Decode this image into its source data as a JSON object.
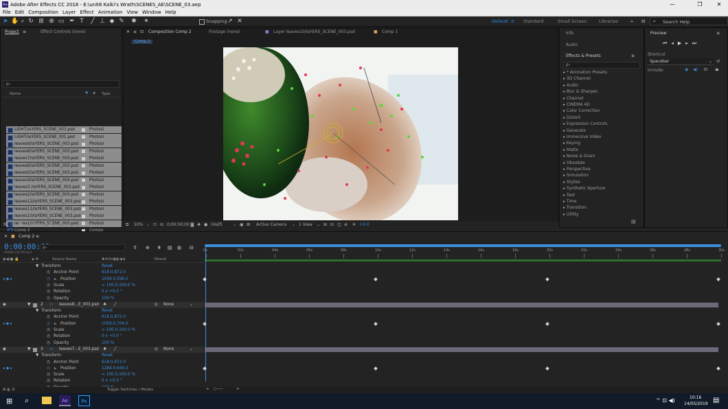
{
  "window": {
    "title": "Adobe After Effects CC 2018 - E:\\unit8 Kalki's Wrath\\SCENES_AE\\SCENE_03.aep",
    "controls": [
      "—",
      "❐",
      "✕"
    ]
  },
  "menu": [
    "File",
    "Edit",
    "Composition",
    "Layer",
    "Effect",
    "Animation",
    "View",
    "Window",
    "Help"
  ],
  "toolbar": {
    "snapping": "Snapping",
    "workspaces": [
      "Default",
      "Standard",
      "Small Screen",
      "Libraries"
    ],
    "active_workspace": "Default",
    "search_help": "Search Help",
    "accent": "#2d8ceb"
  },
  "project_panel": {
    "tabs": [
      "Project",
      "Effect Controls (none)"
    ],
    "col_name": "Name",
    "col_type": "Type",
    "items": [
      {
        "name": "LIGHT/laYERS_SCENE_003.psd",
        "type": "Photosl",
        "selected": true
      },
      {
        "name": "LIGHT/laYERS_SCENE_001.psd",
        "type": "Photosl",
        "selected": true
      },
      {
        "name": "leaves9/laYERS_SCENE_003.psd",
        "type": "Photosl",
        "selected": true
      },
      {
        "name": "leaves8/laYERS_SCENE_003.psd",
        "type": "Photosl",
        "selected": true
      },
      {
        "name": "leaves7/laYERS_SCENE_003.psd",
        "type": "Photosl",
        "selected": true
      },
      {
        "name": "leaves6/laYERS_SCENE_003.psd",
        "type": "Photosl",
        "selected": true
      },
      {
        "name": "leaves5/laYERS_SCENE_003.psd",
        "type": "Photosl",
        "selected": true
      },
      {
        "name": "leaves4/laYERS_SCENE_003.psd",
        "type": "Photosl",
        "selected": true
      },
      {
        "name": "leaves3 /laYERS_SCENE_003.psd",
        "type": "Photosl",
        "selected": true
      },
      {
        "name": "leaves2/laYERS_SCENE_003.psd",
        "type": "Photosl",
        "selected": true
      },
      {
        "name": "leaves12/laYERS_SCENE_003.psd",
        "type": "Photosl",
        "selected": true
      },
      {
        "name": "leaves11/laYERS_SCENE_003.psd",
        "type": "Photosl",
        "selected": true
      },
      {
        "name": "leaves10/laYERS_SCENE_003.psd",
        "type": "Photosl",
        "selected": true
      },
      {
        "name": "leaves1/laYERS_SCENE_003.psd",
        "type": "Photosl",
        "selected": true
      },
      {
        "name": "Comp 2",
        "type": "Compo",
        "selected": false
      },
      {
        "name": "Comp 1",
        "type": "Compo",
        "selected": false
      },
      {
        "name": "BRIDGE8..7/laYERS_SCENE_003.psd",
        "type": "Photosl",
        "selected": false
      },
      {
        "name": "BRIDGE8..7/laYERS_SCENE_003.psd",
        "type": "Photosl",
        "selected": false
      }
    ],
    "bpc": "8 bpc"
  },
  "viewer": {
    "tabs": [
      "Composition Comp 2",
      "Footage (none)",
      "Layer leaves10/laYERS_SCENE_003.psd",
      "Comp 1"
    ],
    "comp_tag": "Comp 2",
    "zoom": "50%",
    "timecode": "0;00;00;00",
    "resolution": "(Half)",
    "camera": "Active Camera",
    "views": "1 View",
    "exposure": "+0.0"
  },
  "right_panels": {
    "info": "Info",
    "audio": "Audio",
    "effects_title": "Effects & Presets",
    "search_placeholder": "ρ₊",
    "effects": [
      "* Animation Presets",
      "3D Channel",
      "Audio",
      "Blur & Sharpen",
      "Channel",
      "CINEMA 4D",
      "Color Correction",
      "Distort",
      "Expression Controls",
      "Generate",
      "Immersive Video",
      "Keying",
      "Matte",
      "Noise & Grain",
      "Obsolete",
      "Perspective",
      "Simulation",
      "Stylize",
      "Synthetic Aperture",
      "Text",
      "Time",
      "Transition",
      "Utility"
    ]
  },
  "preview": {
    "title": "Preview",
    "shortcut_label": "Shortcut",
    "shortcut_value": "Spacebar",
    "include_label": "Include:"
  },
  "timeline": {
    "tab": "Comp 2",
    "timecode": "0:00:00:00",
    "fps": "00000 (30.00 fps)",
    "col_source": "Source Name",
    "col_parent": "Parent",
    "ruler": [
      "0s",
      "02s",
      "04s",
      "06s",
      "08s",
      "10s",
      "12s",
      "14s",
      "16s",
      "18s",
      "20s",
      "22s",
      "24s",
      "26s",
      "28s",
      "30s"
    ],
    "toggle": "Toggle Switches / Modes",
    "layers": [
      {
        "num": "",
        "name": "",
        "transform": "Transform",
        "reset": "Reset",
        "props": [
          {
            "name": "Anchor Point",
            "value": "618.0,872.0",
            "keyed": false
          },
          {
            "name": "Position",
            "value": "1056.0,596.0",
            "keyed": true
          },
          {
            "name": "Scale",
            "value": "∞ 100.0,100.0 %",
            "keyed": false
          },
          {
            "name": "Rotation",
            "value": "0 x +0.0 °",
            "keyed": false
          },
          {
            "name": "Opacity",
            "value": "100 %",
            "keyed": false
          }
        ]
      },
      {
        "num": "2",
        "name": "leaves8...E_003.psd",
        "parent": "None",
        "transform": "Transform",
        "reset": "Reset",
        "props": [
          {
            "name": "Anchor Point",
            "value": "618.0,872.0",
            "keyed": false
          },
          {
            "name": "Position",
            "value": "1056.0,704.0",
            "keyed": true
          },
          {
            "name": "Scale",
            "value": "∞ 100.0,100.0 %",
            "keyed": false
          },
          {
            "name": "Rotation",
            "value": "0 x +0.0 °",
            "keyed": false
          },
          {
            "name": "Opacity",
            "value": "100 %",
            "keyed": false
          }
        ]
      },
      {
        "num": "3",
        "name": "leaves7...E_003.psd",
        "parent": "None",
        "transform": "Transform",
        "reset": "Reset",
        "props": [
          {
            "name": "Anchor Point",
            "value": "618.0,872.0",
            "keyed": false
          },
          {
            "name": "Position",
            "value": "1284.0,640.0",
            "keyed": true
          },
          {
            "name": "Scale",
            "value": "∞ 100.0,100.0 %",
            "keyed": false
          },
          {
            "name": "Rotation",
            "value": "0 x +0.0 °",
            "keyed": false
          },
          {
            "name": "Opacity",
            "value": "100 %",
            "keyed": false
          }
        ]
      }
    ],
    "keyframe_times": [
      [
        0,
        10,
        20,
        30
      ],
      [
        0,
        10,
        20,
        30
      ],
      [
        0,
        10,
        20,
        30
      ]
    ]
  },
  "taskbar": {
    "time": "10:16",
    "date": "14/05/2019",
    "apps": [
      "Ae",
      "Ps"
    ]
  }
}
